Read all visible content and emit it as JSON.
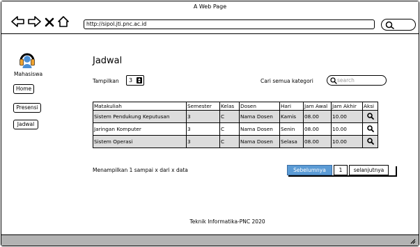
{
  "browser": {
    "window_title": "A Web Page",
    "url": "http://sipol.jti.pnc.ac.id"
  },
  "sidebar": {
    "role_label": "Mahasiswa",
    "items": [
      {
        "label": "Home"
      },
      {
        "label": "Presensi"
      },
      {
        "label": "Jadwal"
      }
    ]
  },
  "main": {
    "title": "Jadwal",
    "show_label": "Tampilkan",
    "show_value": "3",
    "search_label": "Cari semua kategori",
    "search_placeholder": "search",
    "table": {
      "columns": [
        "Matakuliah",
        "Semester",
        "Kelas",
        "Dosen",
        "Hari",
        "Jam Awal",
        "Jam Akhir",
        "Aksi"
      ],
      "rows": [
        [
          "Sistem Pendukung Keputusan",
          "3",
          "C",
          "Nama Dosen",
          "Kamis",
          "08.00",
          "10.00"
        ],
        [
          "Jaringan Komputer",
          "3",
          "C",
          "Nama Dosen",
          "Senin",
          "08.00",
          "10.00"
        ],
        [
          "Sistem Operasi",
          "3",
          "C",
          "Nama Dosen",
          "Selasa",
          "08.00",
          "10.00"
        ]
      ],
      "action_icon": "search-icon"
    },
    "info_text": "Menampilkan 1 sampai x dari x data",
    "pagination": {
      "prev_label": "Sebelumnya",
      "page": "1",
      "next_label": "selanjutnya"
    }
  },
  "footer": {
    "text": "Teknik Informatika-PNC 2020"
  },
  "colors": {
    "accent": "#5b9bd5",
    "row_alt": "#dcdcdc",
    "statusbar": "#b3b3b3"
  }
}
